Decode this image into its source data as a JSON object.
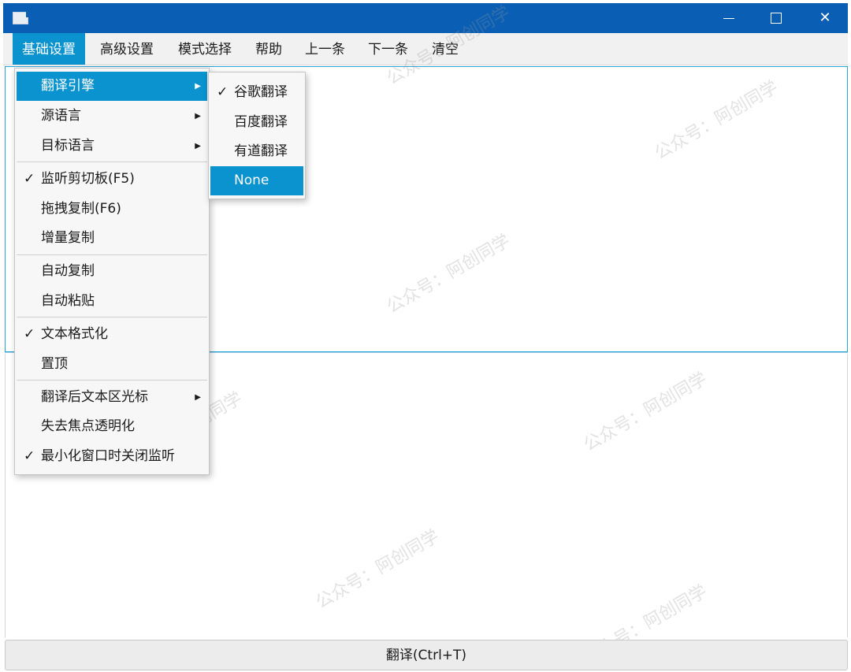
{
  "window": {
    "minimize_glyph": "—",
    "maximize_glyph": "□",
    "close_glyph": "✕"
  },
  "menubar": {
    "items": [
      "基础设置",
      "高级设置",
      "模式选择",
      "帮助",
      "上一条",
      "下一条",
      "清空"
    ]
  },
  "dropdown": {
    "items": [
      {
        "label": "翻译引擎",
        "checked": false,
        "submenu": true
      },
      {
        "label": "源语言",
        "checked": false,
        "submenu": true
      },
      {
        "label": "目标语言",
        "checked": false,
        "submenu": true
      },
      {
        "label": "监听剪切板(F5)",
        "checked": true,
        "submenu": false
      },
      {
        "label": "拖拽复制(F6)",
        "checked": false,
        "submenu": false
      },
      {
        "label": "增量复制",
        "checked": false,
        "submenu": false
      },
      {
        "label": "自动复制",
        "checked": false,
        "submenu": false
      },
      {
        "label": "自动粘贴",
        "checked": false,
        "submenu": false
      },
      {
        "label": "文本格式化",
        "checked": true,
        "submenu": false
      },
      {
        "label": "置顶",
        "checked": false,
        "submenu": false
      },
      {
        "label": "翻译后文本区光标",
        "checked": false,
        "submenu": true
      },
      {
        "label": "失去焦点透明化",
        "checked": false,
        "submenu": false
      },
      {
        "label": "最小化窗口时关闭监听",
        "checked": true,
        "submenu": false
      }
    ]
  },
  "submenu": {
    "items": [
      {
        "label": "谷歌翻译",
        "checked": true
      },
      {
        "label": "百度翻译",
        "checked": false
      },
      {
        "label": "有道翻译",
        "checked": false
      },
      {
        "label": "None",
        "checked": false
      }
    ]
  },
  "glyphs": {
    "check": "✓",
    "arrow": "▶"
  },
  "translate_button": {
    "label": "翻译(Ctrl+T)"
  },
  "watermark": {
    "text": "公众号：阿创同学"
  },
  "colors": {
    "titlebar": "#0a5fb4",
    "accent": "#0a93cf"
  }
}
